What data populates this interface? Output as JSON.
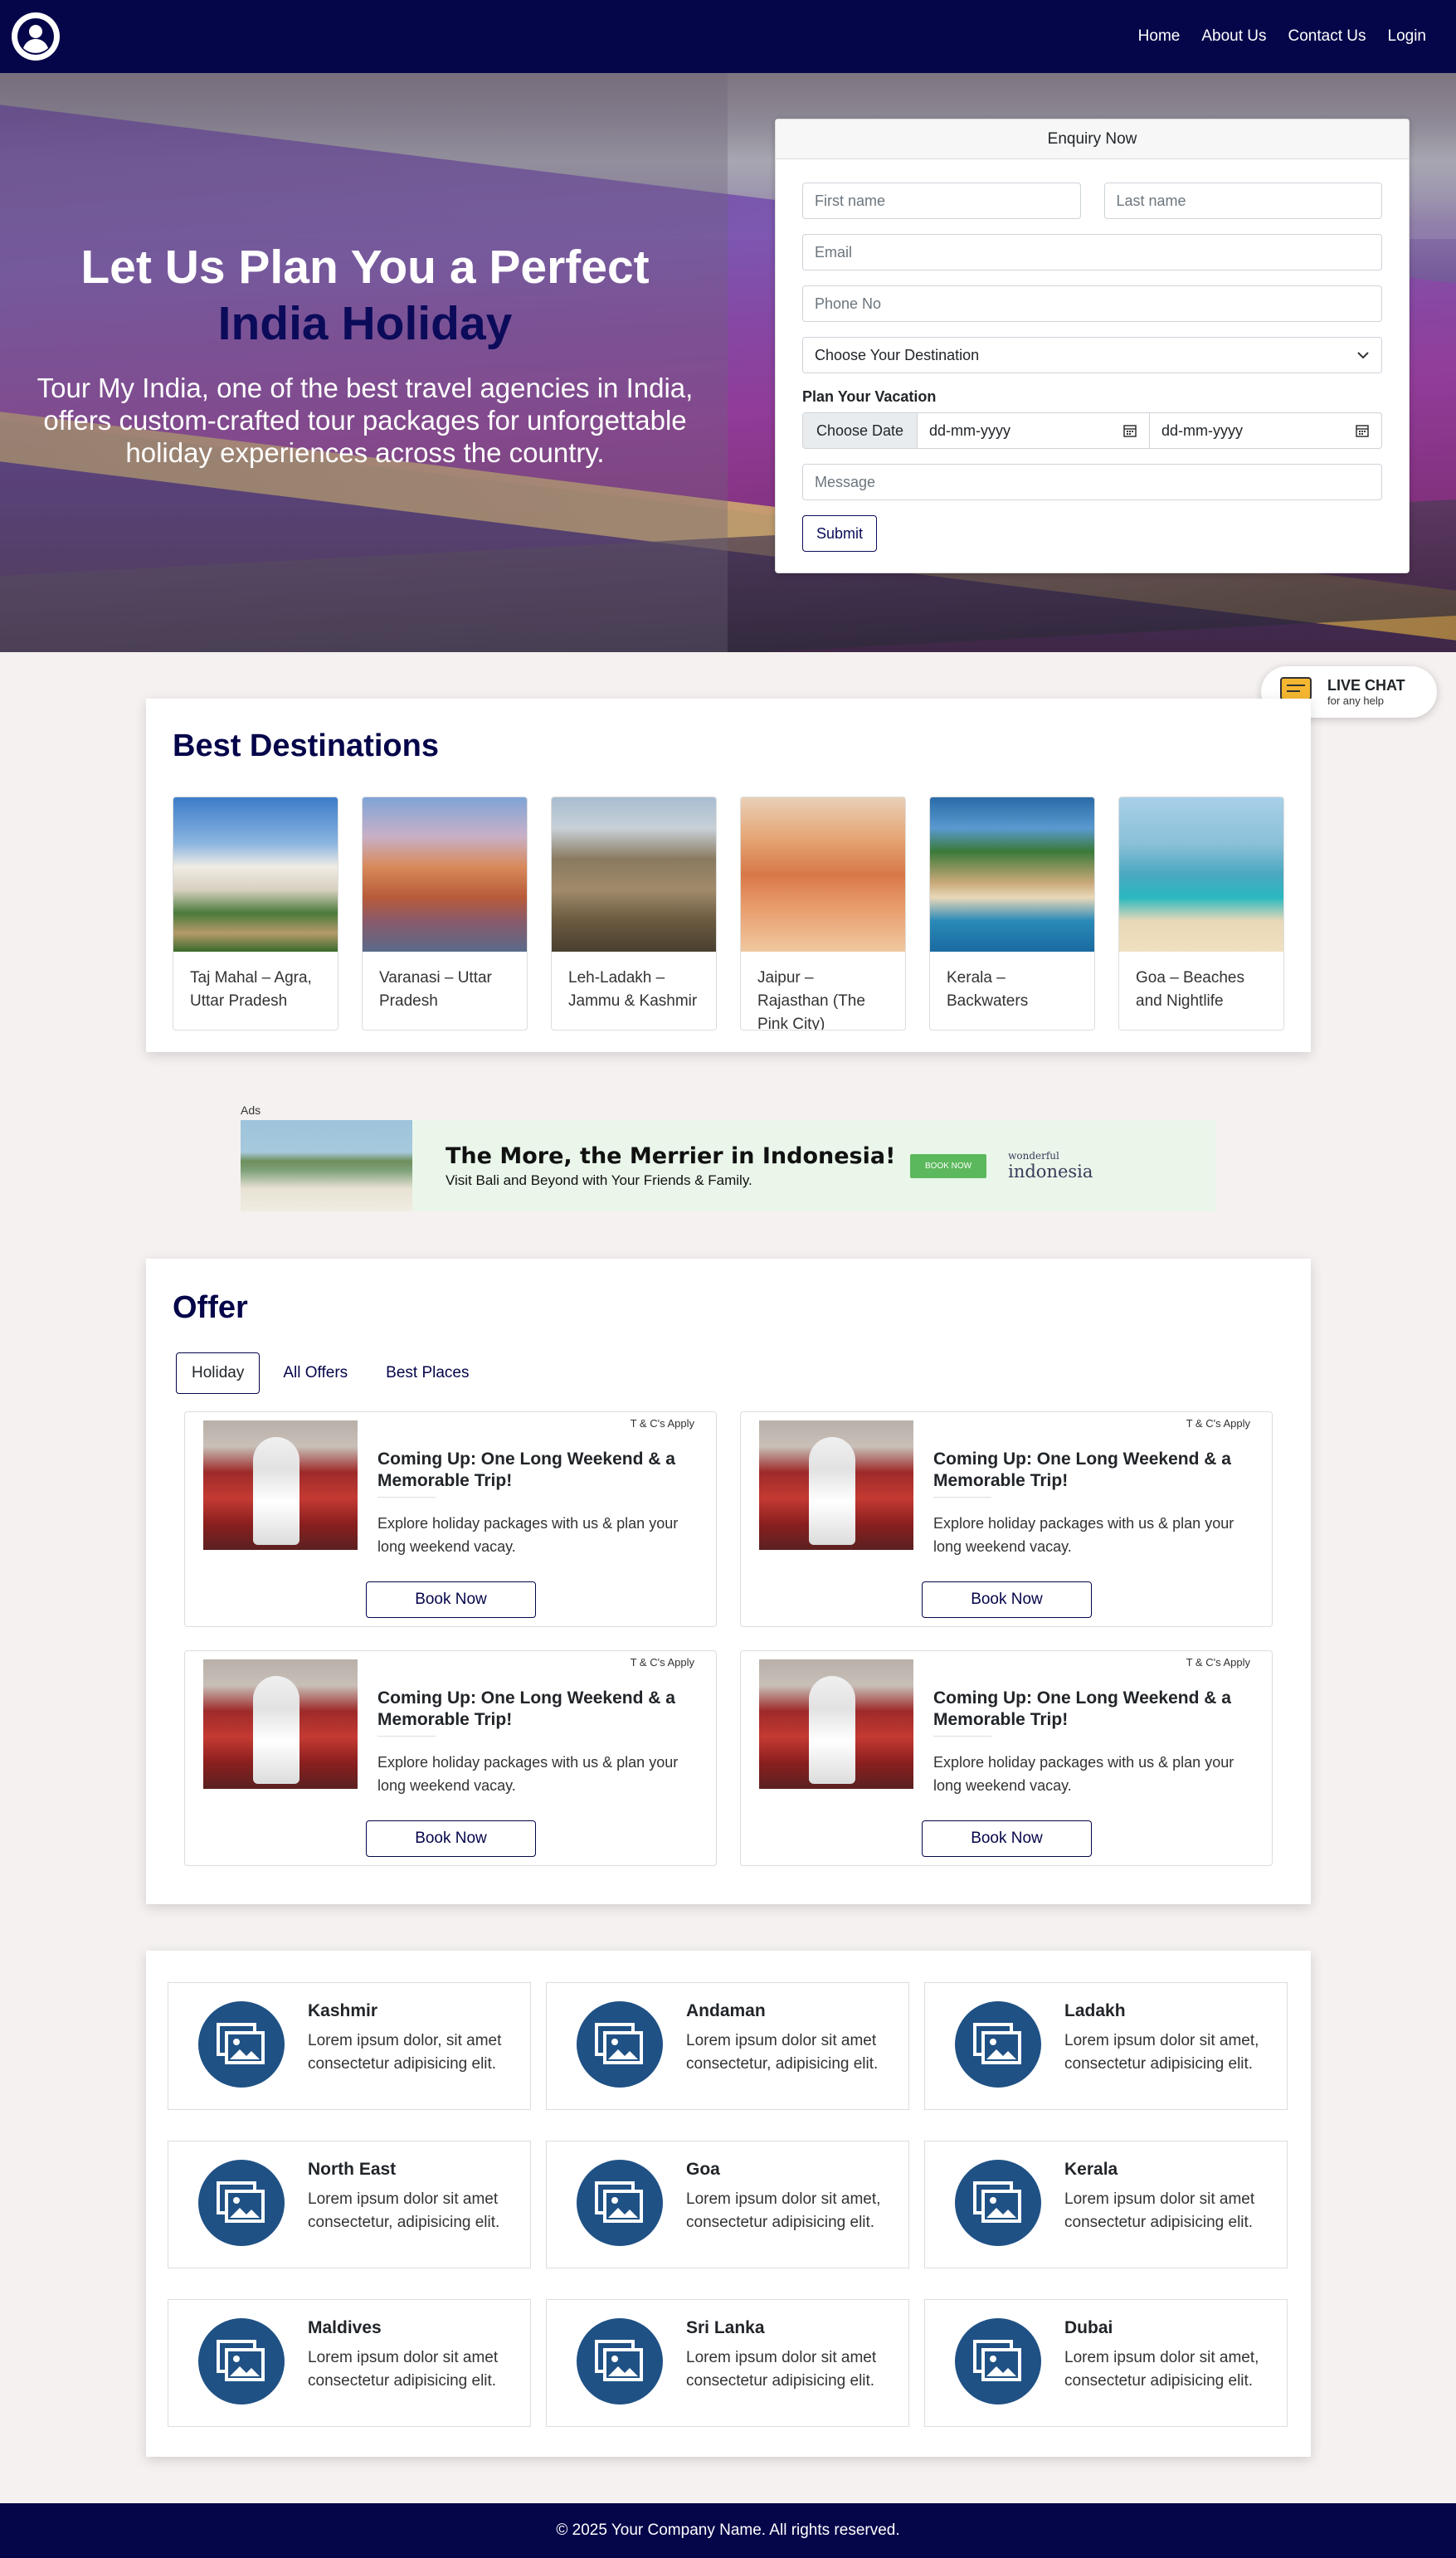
{
  "nav": {
    "links": [
      "Home",
      "About Us",
      "Contact Us",
      "Login"
    ]
  },
  "hero": {
    "title_line1": "Let Us Plan You a Perfect",
    "title_line2": "India Holiday",
    "description": "Tour My India, one of the best travel agencies in India, offers custom-crafted tour packages for unforgettable holiday experiences across the country."
  },
  "enquiry": {
    "header": "Enquiry Now",
    "first_name_placeholder": "First name",
    "last_name_placeholder": "Last name",
    "email_placeholder": "Email",
    "phone_placeholder": "Phone No",
    "destination_selected": "Choose Your Destination",
    "plan_label": "Plan Your Vacation",
    "choose_date_label": "Choose Date",
    "date_from_placeholder": "dd-mm-yyyy",
    "date_to_placeholder": "dd-mm-yyyy",
    "message_placeholder": "Message",
    "submit_label": "Submit"
  },
  "live_chat": {
    "title": "LIVE CHAT",
    "subtitle": "for any help"
  },
  "destinations": {
    "title": "Best Destinations",
    "items": [
      {
        "caption": "Taj Mahal – Agra, Uttar Pradesh"
      },
      {
        "caption": "Varanasi – Uttar Pradesh"
      },
      {
        "caption": "Leh-Ladakh – Jammu & Kashmir"
      },
      {
        "caption": "Jaipur – Rajasthan (The Pink City)"
      },
      {
        "caption": "Kerala – Backwaters"
      },
      {
        "caption": "Goa – Beaches and Nightlife"
      }
    ]
  },
  "ads": {
    "label": "Ads",
    "headline": "The More, the Merrier in Indonesia!",
    "subline": "Visit Bali and Beyond with Your Friends & Family.",
    "button": "BOOK NOW",
    "brand_small": "wonderful",
    "brand": "indonesia"
  },
  "offer": {
    "title": "Offer",
    "tabs": [
      "Holiday",
      "All Offers",
      "Best Places"
    ],
    "active_tab": "Holiday",
    "cards": [
      {
        "tc": "T & C's Apply",
        "title": "Coming Up: One Long Weekend & a Memorable Trip!",
        "text": "Explore holiday packages with us & plan your long weekend vacay.",
        "button": "Book Now"
      },
      {
        "tc": "T & C's Apply",
        "title": "Coming Up: One Long Weekend & a Memorable Trip!",
        "text": "Explore holiday packages with us & plan your long weekend vacay.",
        "button": "Book Now"
      },
      {
        "tc": "T & C's Apply",
        "title": "Coming Up: One Long Weekend & a Memorable Trip!",
        "text": "Explore holiday packages with us & plan your long weekend vacay.",
        "button": "Book Now"
      },
      {
        "tc": "T & C's Apply",
        "title": "Coming Up: One Long Weekend & a Memorable Trip!",
        "text": "Explore holiday packages with us & plan your long weekend vacay.",
        "button": "Book Now"
      }
    ]
  },
  "places": [
    {
      "name": "Kashmir",
      "text": "Lorem ipsum dolor, sit amet consectetur adipisicing elit."
    },
    {
      "name": "Andaman",
      "text": "Lorem ipsum dolor sit amet consectetur, adipisicing elit."
    },
    {
      "name": "Ladakh",
      "text": "Lorem ipsum dolor sit amet, consectetur adipisicing elit."
    },
    {
      "name": "North East",
      "text": "Lorem ipsum dolor sit amet consectetur, adipisicing elit."
    },
    {
      "name": "Goa",
      "text": "Lorem ipsum dolor sit amet, consectetur adipisicing elit."
    },
    {
      "name": "Kerala",
      "text": "Lorem ipsum dolor sit amet consectetur adipisicing elit."
    },
    {
      "name": "Maldives",
      "text": "Lorem ipsum dolor sit amet consectetur adipisicing elit."
    },
    {
      "name": "Sri Lanka",
      "text": "Lorem ipsum dolor sit amet consectetur adipisicing elit."
    },
    {
      "name": "Dubai",
      "text": "Lorem ipsum dolor sit amet, consectetur adipisicing elit."
    }
  ],
  "footer": {
    "text": "© 2025 Your Company Name. All rights reserved."
  },
  "colors": {
    "navy": "#05054a",
    "place_icon_bg": "#1f5185",
    "page_bg": "#f5f1f0"
  }
}
